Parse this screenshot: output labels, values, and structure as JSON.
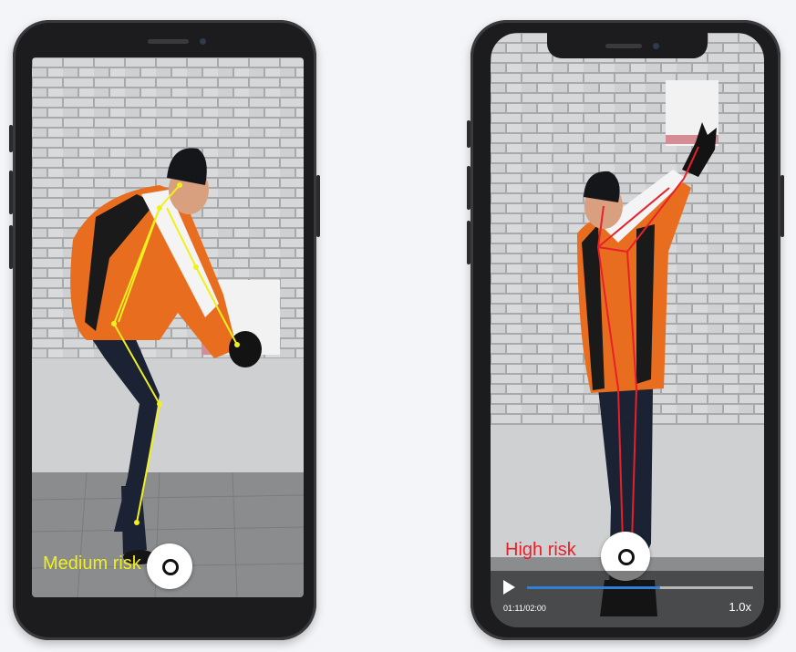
{
  "left_phone": {
    "risk_label": "Medium risk",
    "risk_color": "#f0f01e"
  },
  "right_phone": {
    "risk_label": "High risk",
    "risk_color": "#e8202a",
    "player": {
      "time": "01:11/02:00",
      "speed": "1.0x",
      "progress": 0.59,
      "accent": "#2f7fd9"
    }
  },
  "colors": {
    "wall": "#b9bbbd",
    "pose_medium": "#f0f01e",
    "pose_high": "#e8202a",
    "jacket": "#e96d1f"
  }
}
